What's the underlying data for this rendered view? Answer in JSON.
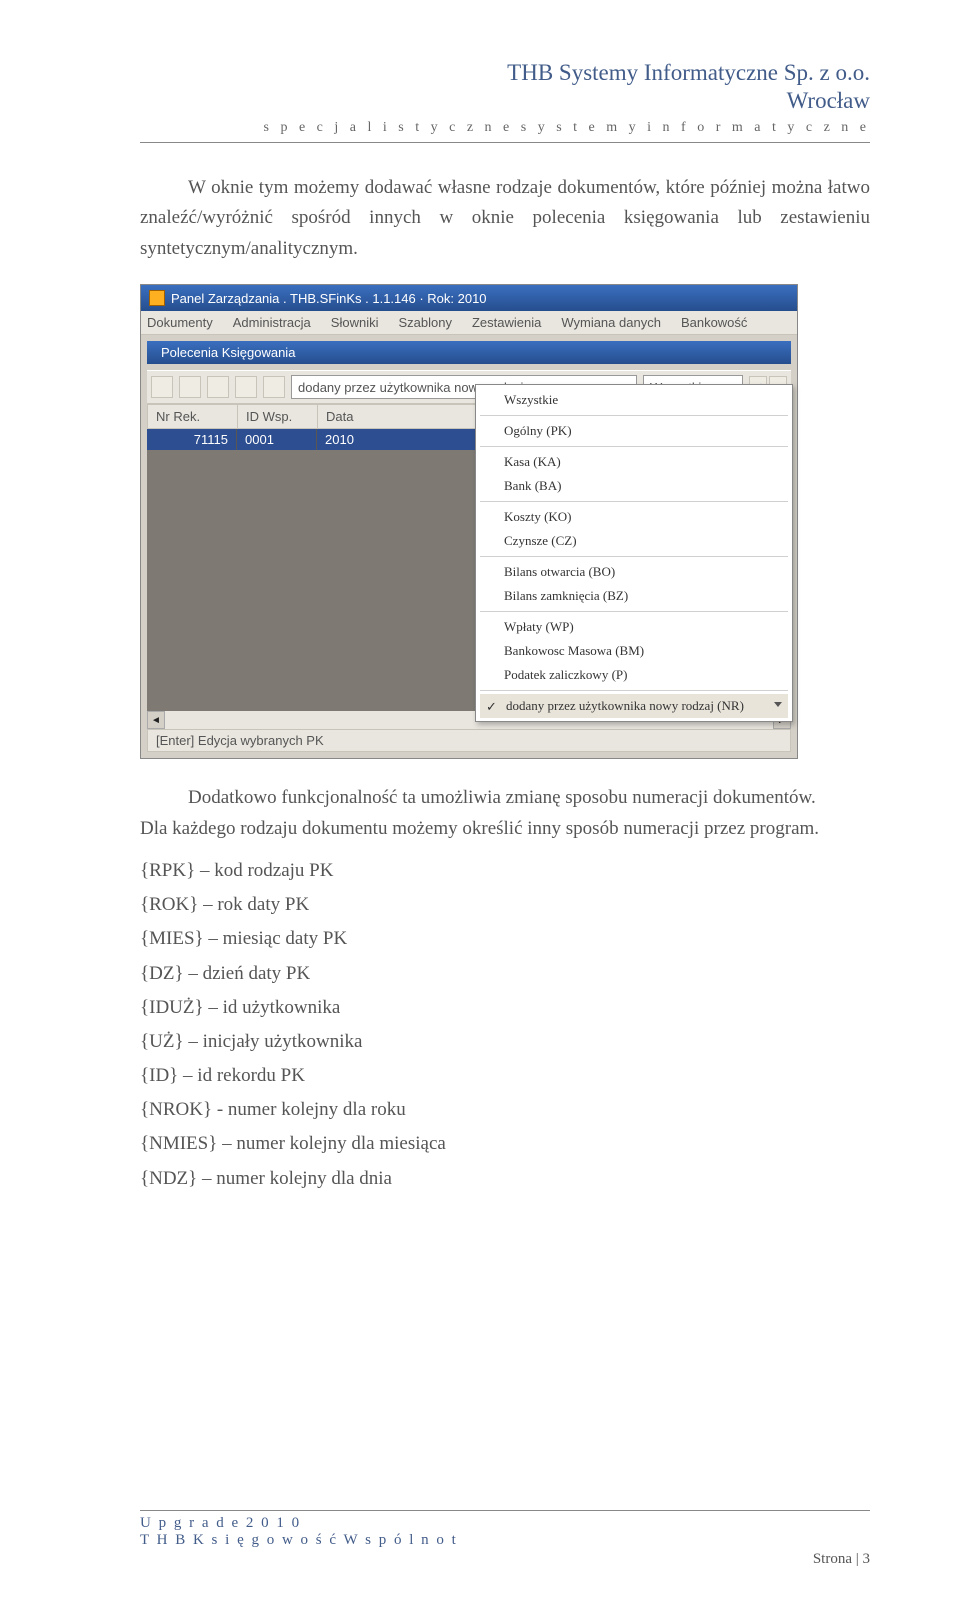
{
  "header": {
    "company": "THB Systemy Informatyczne Sp. z o.o.",
    "city": "Wrocław",
    "tagline": "s p e c j a l i s t y c z n e   s y s t e m y   i n f o r m a t y c z n e"
  },
  "body": {
    "intro": "W oknie tym możemy dodawać własne rodzaje dokumentów, które później można łatwo znaleźć/wyróżnić spośród innych w oknie polecenia księgowania lub zestawieniu syntetycznym/analitycznym.",
    "after": "Dodatkowo funkcjonalność ta umożliwia zmianę sposobu numeracji dokumentów.",
    "after2": "Dla każdego rodzaju dokumentu możemy określić inny sposób numeracji przez program.",
    "codes": [
      "{RPK} – kod rodzaju PK",
      "{ROK} – rok daty PK",
      "{MIES} – miesiąc daty PK",
      "{DZ} – dzień daty PK",
      "{IDUŻ} – id użytkownika",
      "{UŻ} – inicjały użytkownika",
      "{ID} – id rekordu PK",
      "{NROK} - numer kolejny dla roku",
      "{NMIES} – numer kolejny dla miesiąca",
      "{NDZ} – numer kolejny dla dnia"
    ]
  },
  "app": {
    "titlebar": "Panel Zarządzania . THB.SFinKs . 1.1.146 · Rok: 2010",
    "menu": [
      "Dokumenty",
      "Administracja",
      "Słowniki",
      "Szablony",
      "Zestawienia",
      "Wymiana danych",
      "Bankowość"
    ],
    "panel_title": "Polecenia Księgowania",
    "toolbar": {
      "combo1": "dodany przez użytkownika nowy rodzaj",
      "combo2": "Wszystkie"
    },
    "grid": {
      "headers": [
        "Nr Rek.",
        "ID Wsp.",
        "Data"
      ],
      "rows": [
        {
          "nr": "71115",
          "id": "0001",
          "data": "2010"
        }
      ]
    },
    "dropdown": [
      "Wszystkie",
      "Ogólny (PK)",
      "Kasa (KA)",
      "Bank (BA)",
      "Koszty (KO)",
      "Czynsze (CZ)",
      "Bilans otwarcia (BO)",
      "Bilans zamknięcia (BZ)",
      "Wpłaty (WP)",
      "Bankowosc Masowa (BM)",
      "Podatek zaliczkowy (P)",
      "dodany przez użytkownika nowy rodzaj (NR)"
    ],
    "status": "[Enter] Edycja wybranych PK"
  },
  "footer": {
    "line1": "U p g r a d e   2 0 1 0",
    "line2": "T H B   K s i ę g o w o ś ć   W s p ó l n o t",
    "page": "Strona | 3"
  }
}
